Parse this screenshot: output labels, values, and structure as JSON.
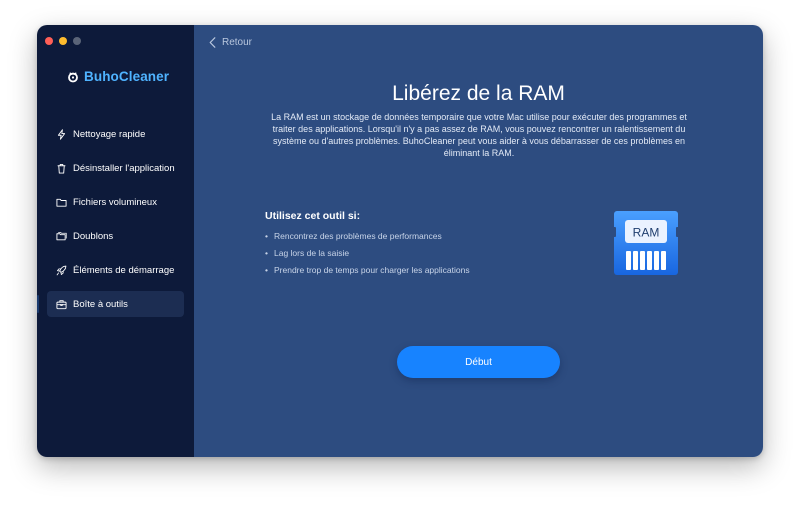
{
  "app": {
    "name": "BuhoCleaner",
    "brand_color": "#4fb3ff"
  },
  "window_controls": [
    "close",
    "minimize",
    "zoom"
  ],
  "sidebar": {
    "items": [
      {
        "label": "Nettoyage rapide",
        "icon": "lightning-icon",
        "active": false
      },
      {
        "label": "Désinstaller l'application",
        "icon": "trash-icon",
        "active": false
      },
      {
        "label": "Fichiers volumineux",
        "icon": "folder-icon",
        "active": false
      },
      {
        "label": "Doublons",
        "icon": "duplicate-folder-icon",
        "active": false
      },
      {
        "label": "Éléments de démarrage",
        "icon": "rocket-icon",
        "active": false
      },
      {
        "label": "Boîte à outils",
        "icon": "toolbox-icon",
        "active": true
      }
    ]
  },
  "header": {
    "back_label": "Retour"
  },
  "main": {
    "title": "Libérez de la RAM",
    "description": "La RAM est un stockage de données temporaire que votre Mac utilise pour exécuter des programmes et traiter des applications. Lorsqu'il n'y a pas assez de RAM, vous pouvez rencontrer un ralentissement du système ou d'autres problèmes. BuhoCleaner peut vous aider à vous débarrasser de ces problèmes en éliminant la RAM.",
    "usage_title": "Utilisez cet outil si:",
    "usage_items": [
      "Rencontrez des problèmes de performances",
      "Lag lors de la saisie",
      "Prendre trop de temps pour charger les applications"
    ],
    "ram_label": "RAM",
    "start_label": "Début"
  },
  "colors": {
    "sidebar_bg": "#0d1a3a",
    "main_bg": "#2d4c80",
    "accent": "#1783ff"
  }
}
